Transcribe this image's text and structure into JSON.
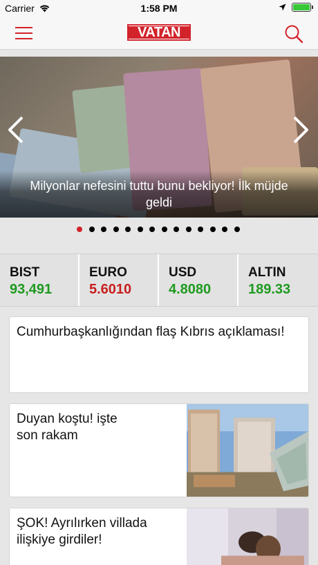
{
  "status_bar": {
    "carrier": "Carrier",
    "time": "1:58 PM"
  },
  "header": {
    "logo": "VATAN",
    "brand_color": "#d2222a"
  },
  "hero": {
    "caption": "Milyonlar nefesini tuttu bunu bekliyor! İlk müjde geldi",
    "slide_count": 14,
    "active_slide": 1
  },
  "markets": [
    {
      "name": "BIST",
      "value": "93,491",
      "color": "#1f9a1f"
    },
    {
      "name": "EURO",
      "value": "5.6010",
      "color": "#c81e1e"
    },
    {
      "name": "USD",
      "value": "4.8080",
      "color": "#1f9a1f"
    },
    {
      "name": "ALTIN",
      "value": "189.33",
      "color": "#1f9a1f"
    }
  ],
  "news": [
    {
      "title": "Cumhurbaşkanlığından flaş Kıbrıs açıklaması!"
    },
    {
      "title": "Duyan koştu! işte son rakam"
    },
    {
      "title": "ŞOK! Ayrılırken villada ilişkiye girdiler!"
    }
  ]
}
